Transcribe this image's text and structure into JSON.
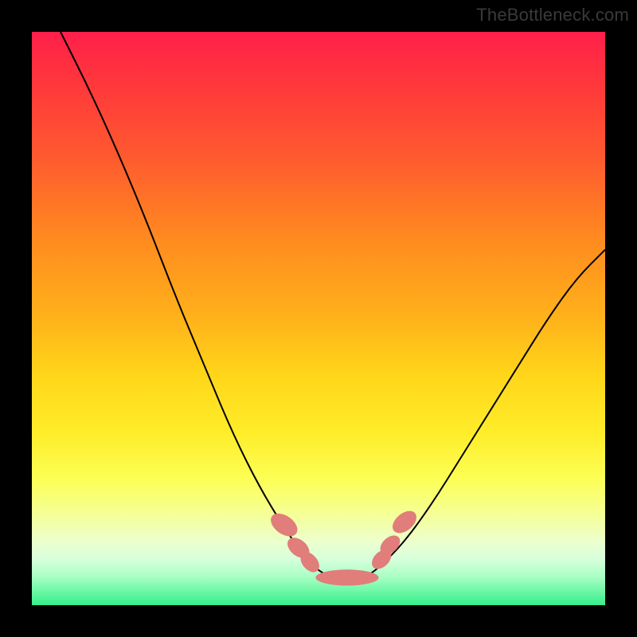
{
  "watermark": "TheBottleneck.com",
  "colors": {
    "gradient_top": "#ff1f4a",
    "gradient_mid": "#ffed2a",
    "gradient_bottom": "#35f08a",
    "curve_stroke": "#000000",
    "pod_fill": "#e17d7a",
    "frame": "#000000"
  },
  "chart_data": {
    "type": "line",
    "title": "",
    "xlabel": "",
    "ylabel": "",
    "xlim": [
      0,
      100
    ],
    "ylim": [
      0,
      100
    ],
    "y_direction_note": "y=0 at bottom (green), y=100 at top (red)",
    "series": [
      {
        "name": "bottleneck-v-curve",
        "x": [
          5,
          10,
          15,
          20,
          25,
          30,
          35,
          40,
          45,
          48,
          50,
          52,
          55,
          58,
          60,
          65,
          70,
          75,
          80,
          85,
          90,
          95,
          100
        ],
        "y": [
          100,
          90,
          79,
          67,
          54,
          42,
          30,
          20,
          12,
          8,
          6,
          5,
          5,
          5,
          6,
          11,
          18,
          26,
          34,
          42,
          50,
          57,
          62
        ]
      }
    ],
    "markers": [
      {
        "name": "left-pod-upper",
        "x": 44.0,
        "y": 14.0,
        "rx": 1.6,
        "ry": 2.6,
        "rot": -55
      },
      {
        "name": "left-pod-mid",
        "x": 46.5,
        "y": 10.0,
        "rx": 1.4,
        "ry": 2.2,
        "rot": -50
      },
      {
        "name": "left-pod-low",
        "x": 48.5,
        "y": 7.5,
        "rx": 1.3,
        "ry": 2.0,
        "rot": -40
      },
      {
        "name": "bottom-pod",
        "x": 55.0,
        "y": 4.8,
        "rx": 5.5,
        "ry": 1.4,
        "rot": 0
      },
      {
        "name": "right-pod-low",
        "x": 61.0,
        "y": 8.0,
        "rx": 1.3,
        "ry": 2.0,
        "rot": 45
      },
      {
        "name": "right-pod-mid",
        "x": 62.5,
        "y": 10.5,
        "rx": 1.3,
        "ry": 2.0,
        "rot": 48
      },
      {
        "name": "right-pod-upper",
        "x": 65.0,
        "y": 14.5,
        "rx": 1.5,
        "ry": 2.4,
        "rot": 50
      }
    ]
  }
}
